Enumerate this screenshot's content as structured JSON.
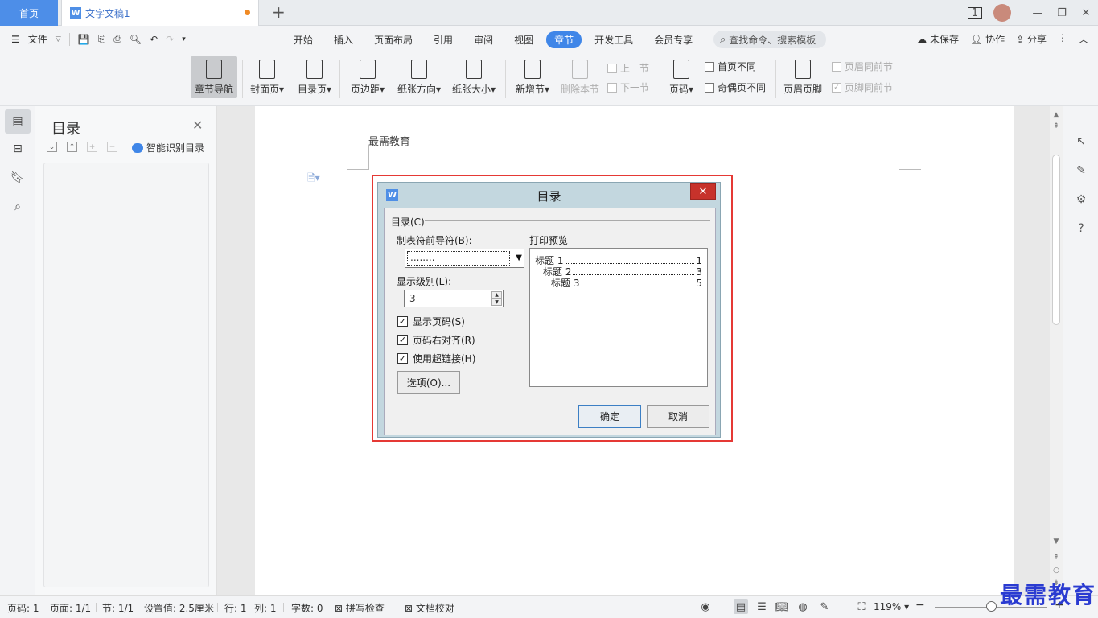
{
  "titlebar": {
    "home_tab": "首页",
    "doc_tab": "文字文稿1",
    "new_tab": "+",
    "window_badge": "1"
  },
  "menubar": {
    "file": "文件",
    "tabs": [
      "开始",
      "插入",
      "页面布局",
      "引用",
      "审阅",
      "视图",
      "章节",
      "开发工具",
      "会员专享"
    ],
    "active_tab": "章节",
    "search_placeholder": "查找命令、搜索模板",
    "unsaved": "未保存",
    "collab": "协作",
    "share": "分享"
  },
  "ribbon": {
    "nav": "章节导航",
    "cover": "封面页",
    "toc_page": "目录页",
    "margin": "页边距",
    "orientation": "纸张方向",
    "size": "纸张大小",
    "new_section": "新增节",
    "delete_section": "删除本节",
    "prev_section": "上一节",
    "next_section": "下一节",
    "page_num": "页码",
    "first_page_diff": "首页不同",
    "odd_even_diff": "奇偶页不同",
    "header_footer": "页眉页脚",
    "header_same_prev": "页眉同前节",
    "footer_same_prev": "页脚同前节"
  },
  "toc_panel": {
    "title": "目录",
    "smart_toc": "智能识别目录"
  },
  "document": {
    "header_text": "最需教育"
  },
  "dialog": {
    "title": "目录",
    "group_label": "目录(C)",
    "leader_label": "制表符前导符(B):",
    "leader_value": "........",
    "levels_label": "显示级别(L):",
    "levels_value": "3",
    "show_page_numbers": "显示页码(S)",
    "right_align": "页码右对齐(R)",
    "use_hyperlinks": "使用超链接(H)",
    "options_button": "选项(O)...",
    "preview_label": "打印预览",
    "preview_rows": [
      {
        "text": "标题 1",
        "page": "1"
      },
      {
        "text": "标题 2",
        "page": "3"
      },
      {
        "text": "标题 3",
        "page": "5"
      }
    ],
    "ok_button": "确定",
    "cancel_button": "取消"
  },
  "statusbar": {
    "page_num": "页码: 1",
    "page": "页面: 1/1",
    "section": "节: 1/1",
    "setting": "设置值: 2.5厘米",
    "row": "行: 1",
    "col": "列: 1",
    "word_count": "字数: 0",
    "spell_check": "拼写检查",
    "doc_check": "文档校对",
    "zoom": "119%"
  },
  "watermark": "最需教育",
  "colors": {
    "accent": "#3f86e8",
    "dialog_frame": "#c3d7df",
    "highlight_frame": "#e53935",
    "close_red": "#c7322b"
  }
}
